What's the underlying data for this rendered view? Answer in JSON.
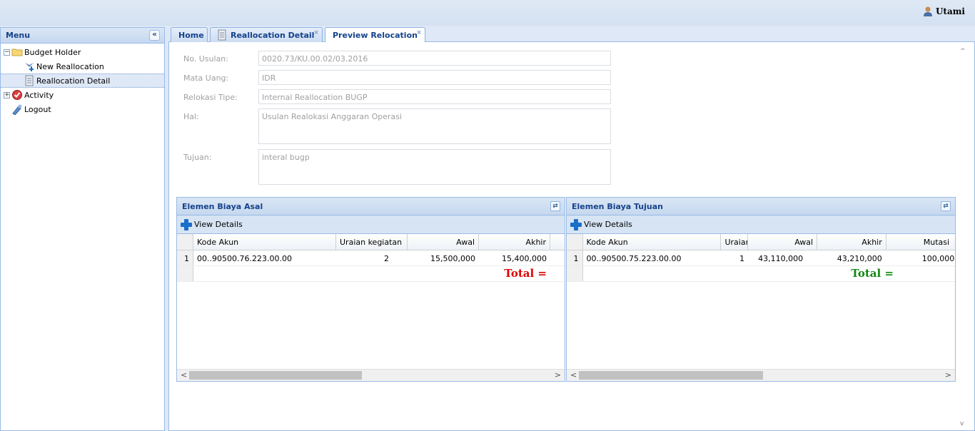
{
  "header": {
    "user_name": "Utami",
    "user_icon": "user-icon"
  },
  "menu": {
    "title": "Menu",
    "collapse_glyph": "«",
    "items": [
      {
        "label": "Budget Holder",
        "icon": "folder-icon",
        "expander": "−"
      },
      {
        "label": "New Reallocation",
        "icon": "new-document-icon"
      },
      {
        "label": "Reallocation Detail",
        "icon": "document-list-icon"
      },
      {
        "label": "Activity",
        "icon": "activity-icon",
        "expander": "+"
      },
      {
        "label": "Logout",
        "icon": "logout-icon"
      }
    ]
  },
  "tabs": [
    {
      "label": "Home"
    },
    {
      "label": "Reallocation Detail",
      "close": "×"
    },
    {
      "label": "Preview Relocation",
      "close": "×"
    }
  ],
  "form": {
    "no_usulan": {
      "label": "No. Usulan:",
      "value": "0020.73/KU.00.02/03.2016"
    },
    "mata_uang": {
      "label": "Mata Uang:",
      "value": "IDR"
    },
    "relokasi_tipe": {
      "label": "Relokasi Tipe:",
      "value": "Internal Reallocation BUGP"
    },
    "hal": {
      "label": "Hal:",
      "value": "Usulan Realokasi Anggaran Operasi"
    },
    "tujuan": {
      "label": "Tujuan:",
      "value": "interal bugp"
    }
  },
  "grid_asal": {
    "title": "Elemen Biaya Asal",
    "refresh_glyph": "⇄",
    "toolbar_label": "View Details",
    "columns": [
      "Kode Akun",
      "Uraian kegiatan",
      "Awal",
      "Akhir"
    ],
    "rows": [
      {
        "no": "1",
        "kode_akun": "00..90500.76.223.00.00",
        "uraian": "2",
        "awal": "15,500,000",
        "akhir": "15,400,000"
      }
    ],
    "total_label": "Total =",
    "total_color": "#e00000"
  },
  "grid_tujuan": {
    "title": "Elemen Biaya Tujuan",
    "refresh_glyph": "⇄",
    "toolbar_label": "View Details",
    "columns": [
      "Kode Akun",
      "Uraian",
      "Awal",
      "Akhir",
      "Mutasi"
    ],
    "rows": [
      {
        "no": "1",
        "kode_akun": "00..90500.75.223.00.00",
        "uraian": "1",
        "awal": "43,110,000",
        "akhir": "43,210,000",
        "mutasi": "100,000"
      }
    ],
    "total_label": "Total =",
    "total_color": "#118811"
  },
  "scroll": {
    "left": "<",
    "right": ">",
    "up": "^",
    "down": "v"
  }
}
